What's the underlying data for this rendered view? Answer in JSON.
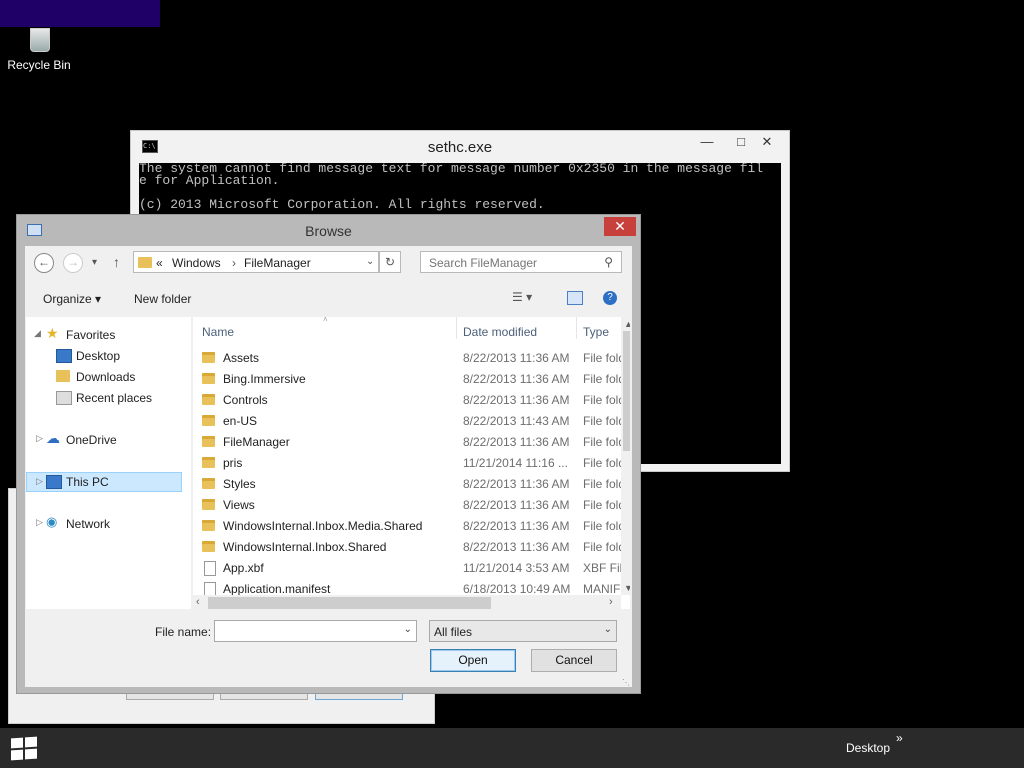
{
  "desktop": {
    "recycle_bin_label": "Recycle Bin"
  },
  "console": {
    "title": "sethc.exe",
    "lines": [
      "The system cannot find message text for message number 0x2350 in the message fil",
      "e for Application.",
      "",
      "(c) 2013 Microsoft Corporation. All rights reserved."
    ]
  },
  "browse": {
    "title": "Browse",
    "address": {
      "prefix": "«",
      "segments": [
        "Windows",
        "FileManager"
      ]
    },
    "search_placeholder": "Search FileManager",
    "toolbar": {
      "organize": "Organize ▾",
      "new_folder": "New folder"
    },
    "nav": {
      "favorites": "Favorites",
      "desktop": "Desktop",
      "downloads": "Downloads",
      "recent": "Recent places",
      "onedrive": "OneDrive",
      "this_pc": "This PC",
      "network": "Network"
    },
    "columns": {
      "name": "Name",
      "date": "Date modified",
      "type": "Type"
    },
    "files": [
      {
        "name": "Assets",
        "date": "8/22/2013 11:36 AM",
        "type": "File folder",
        "kind": "folder"
      },
      {
        "name": "Bing.Immersive",
        "date": "8/22/2013 11:36 AM",
        "type": "File folder",
        "kind": "folder"
      },
      {
        "name": "Controls",
        "date": "8/22/2013 11:36 AM",
        "type": "File folder",
        "kind": "folder"
      },
      {
        "name": "en-US",
        "date": "8/22/2013 11:43 AM",
        "type": "File folder",
        "kind": "folder"
      },
      {
        "name": "FileManager",
        "date": "8/22/2013 11:36 AM",
        "type": "File folder",
        "kind": "folder"
      },
      {
        "name": "pris",
        "date": "11/21/2014 11:16 ...",
        "type": "File folder",
        "kind": "folder"
      },
      {
        "name": "Styles",
        "date": "8/22/2013 11:36 AM",
        "type": "File folder",
        "kind": "folder"
      },
      {
        "name": "Views",
        "date": "8/22/2013 11:36 AM",
        "type": "File folder",
        "kind": "folder"
      },
      {
        "name": "WindowsInternal.Inbox.Media.Shared",
        "date": "8/22/2013 11:36 AM",
        "type": "File folder",
        "kind": "folder"
      },
      {
        "name": "WindowsInternal.Inbox.Shared",
        "date": "8/22/2013 11:36 AM",
        "type": "File folder",
        "kind": "folder"
      },
      {
        "name": "App.xbf",
        "date": "11/21/2014 3:53 AM",
        "type": "XBF File",
        "kind": "file"
      },
      {
        "name": "Application.manifest",
        "date": "6/18/2013 10:49 AM",
        "type": "MANIFEST",
        "kind": "file"
      }
    ],
    "file_name_label": "File name:",
    "file_name_value": "",
    "filter_value": "All files",
    "open_label": "Open",
    "cancel_label": "Cancel"
  },
  "taskbar": {
    "desktop_label": "Desktop",
    "chevron": "»"
  }
}
